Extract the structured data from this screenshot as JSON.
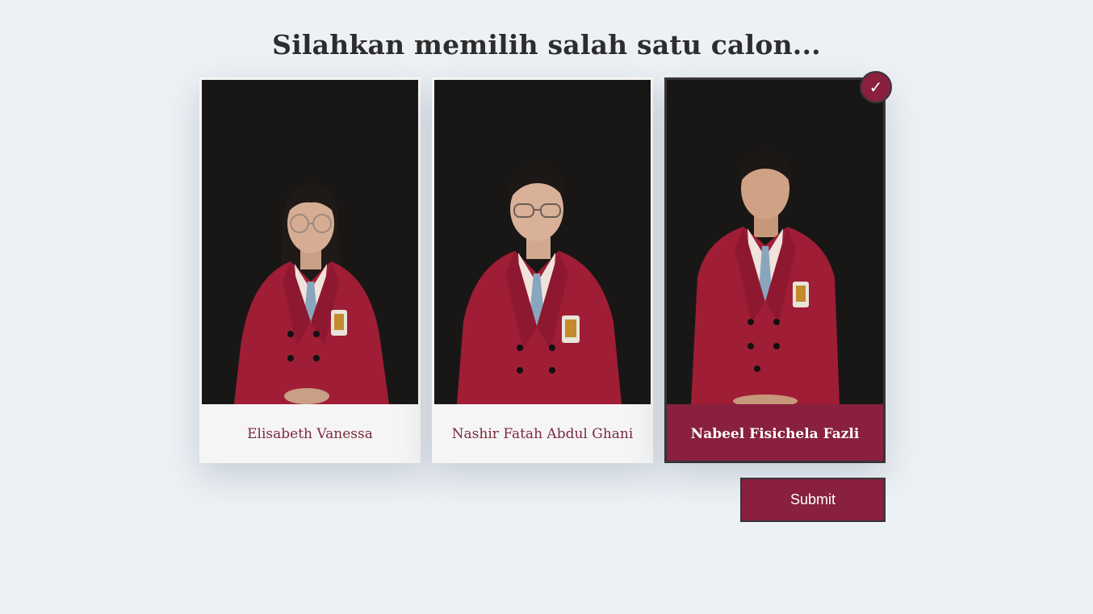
{
  "page": {
    "title": "Silahkan memilih salah satu calon..."
  },
  "candidates": [
    {
      "name": "Elisabeth Vanessa",
      "selected": false
    },
    {
      "name": "Nashir Fatah Abdul Ghani",
      "selected": false
    },
    {
      "name": "Nabeel Fisichela Fazli",
      "selected": true
    }
  ],
  "selection": {
    "check_glyph": "✓"
  },
  "actions": {
    "submit_label": "Submit"
  },
  "colors": {
    "accent": "#88203e",
    "background": "#edf1f5",
    "card": "#f5f5f5",
    "photo_background": "#181716",
    "blazer": "#a01d36",
    "border_dark": "#38343a"
  }
}
